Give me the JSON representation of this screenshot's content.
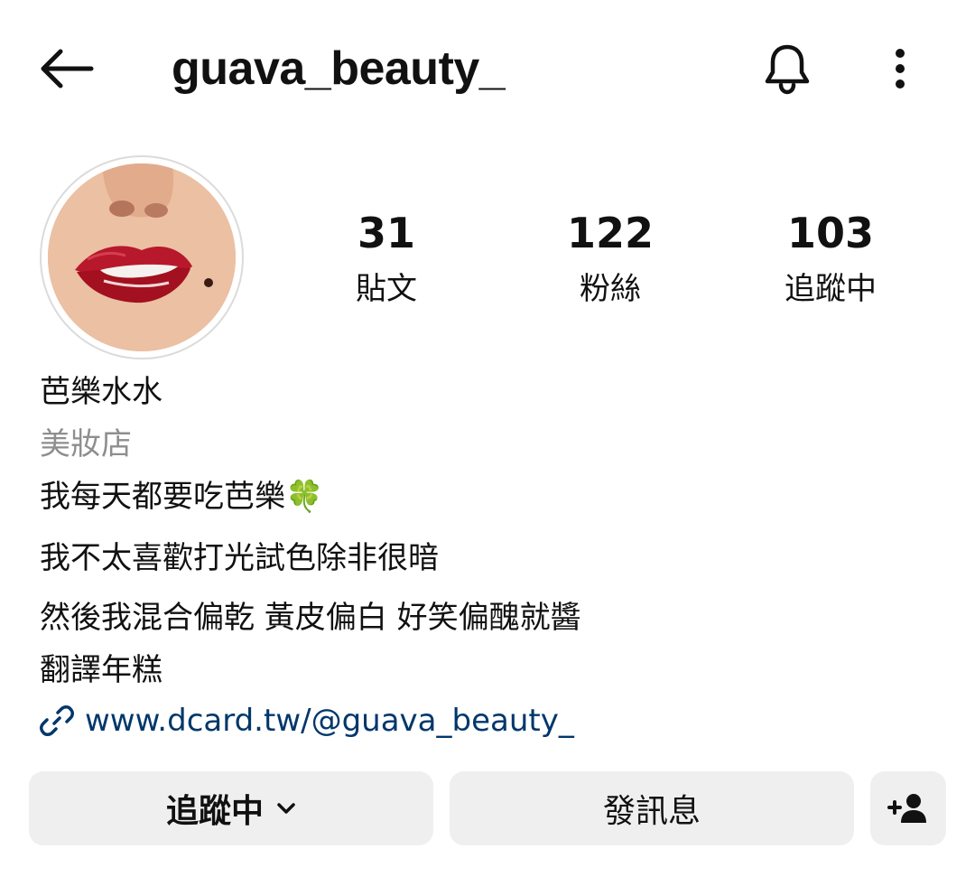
{
  "header": {
    "username": "guava_beauty_"
  },
  "icons": {
    "back": "arrow-left-icon",
    "bell": "bell-icon",
    "more": "more-vertical-icon",
    "link": "link-icon",
    "chevron": "chevron-down-icon",
    "add_person": "add-person-icon",
    "clover": "four-leaf-clover-emoji"
  },
  "stats": {
    "posts": {
      "count": "31",
      "label": "貼文"
    },
    "followers": {
      "count": "122",
      "label": "粉絲"
    },
    "following": {
      "count": "103",
      "label": "追蹤中"
    }
  },
  "profile": {
    "display_name": "芭樂水水",
    "category": "美妝店",
    "bio_lines": [
      "我每天都要吃芭樂🍀",
      "我不太喜歡打光試色除非很暗",
      "然後我混合偏乾 黃皮偏白 好笑偏醜就醬",
      "翻譯年糕"
    ],
    "link": "www.dcard.tw/@guava_beauty_"
  },
  "actions": {
    "following_label": "追蹤中",
    "message_label": "發訊息"
  },
  "colors": {
    "link": "#00376b",
    "button_bg": "#efefef",
    "secondary_text": "#8e8e8e",
    "lip_red": "#c0172c"
  }
}
